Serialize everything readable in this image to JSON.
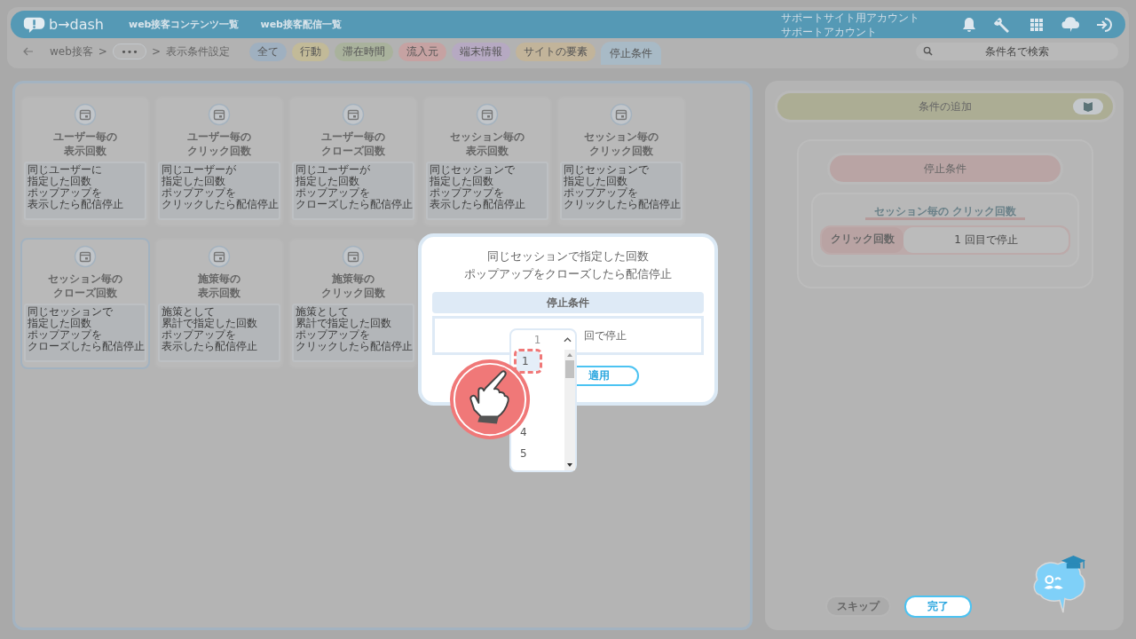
{
  "header": {
    "logo": "b→dash",
    "nav": [
      "web接客コンテンツ一覧",
      "web接客配信一覧"
    ],
    "account": [
      "サポートサイト用アカウント",
      "サポートアカウント"
    ]
  },
  "breadcrumb": [
    {
      "kind": "link",
      "label": "web接客"
    },
    {
      "kind": "sep",
      "label": ">"
    },
    {
      "kind": "more",
      "label": "•••"
    },
    {
      "kind": "sep",
      "label": ">"
    },
    {
      "kind": "current",
      "label": "表示条件設定"
    }
  ],
  "filter_tabs": [
    {
      "label": "全て",
      "color": "#9fb0c0",
      "selected": false
    },
    {
      "label": "行動",
      "color": "#c2ba98",
      "selected": false
    },
    {
      "label": "滞在時間",
      "color": "#a9b29c",
      "selected": false
    },
    {
      "label": "流入元",
      "color": "#c6a2a2",
      "selected": false
    },
    {
      "label": "端末情報",
      "color": "#b6a9c2",
      "selected": false
    },
    {
      "label": "サイトの要素",
      "color": "#c2b49a",
      "selected": false
    },
    {
      "label": "停止条件",
      "color": "#a8bac6",
      "selected": true
    }
  ],
  "search": {
    "placeholder": "条件名で検索"
  },
  "cards": [
    {
      "title": [
        "ユーザー毎の",
        "表示回数"
      ],
      "description": [
        "同じユーザーに",
        "指定した回数",
        "ポップアップを",
        "表示したら配信停止"
      ],
      "selected": false
    },
    {
      "title": [
        "ユーザー毎の",
        "クリック回数"
      ],
      "description": [
        "同じユーザーが",
        "指定した回数",
        "ポップアップを",
        "クリックしたら配信停止"
      ],
      "selected": false
    },
    {
      "title": [
        "ユーザー毎の",
        "クローズ回数"
      ],
      "description": [
        "同じユーザーが",
        "指定した回数",
        "ポップアップを",
        "クローズしたら配信停止"
      ],
      "selected": false
    },
    {
      "title": [
        "セッション毎の",
        "表示回数"
      ],
      "description": [
        "同じセッションで",
        "指定した回数",
        "ポップアップを",
        "表示したら配信停止"
      ],
      "selected": false
    },
    {
      "title": [
        "セッション毎の",
        "クリック回数"
      ],
      "description": [
        "同じセッションで",
        "指定した回数",
        "ポップアップを",
        "クリックしたら配信停止"
      ],
      "selected": false
    },
    {
      "title": [
        "セッション毎の",
        "クローズ回数"
      ],
      "description": [
        "同じセッションで",
        "指定した回数",
        "ポップアップを",
        "クローズしたら配信停止"
      ],
      "selected": true
    },
    {
      "title": [
        "施策毎の",
        "表示回数"
      ],
      "description": [
        "施策として",
        "累計で指定した回数",
        "ポップアップを",
        "表示したら配信停止"
      ],
      "selected": false
    },
    {
      "title": [
        "施策毎の",
        "クリック回数"
      ],
      "description": [
        "施策として",
        "累計で指定した回数",
        "ポップアップを",
        "クリックしたら配信停止"
      ],
      "selected": false
    }
  ],
  "right_panel": {
    "add_button": "条件の追加",
    "group_title": "停止条件",
    "condition": {
      "title": "セッション毎の クリック回数",
      "label": "クリック回数",
      "value": "1 回目で停止"
    }
  },
  "footer_buttons": [
    {
      "kind": "skip",
      "label": "スキップ"
    },
    {
      "kind": "done",
      "label": "完了"
    }
  ],
  "modal": {
    "description": [
      "同じセッションで指定した回数",
      "ポップアップをクローズしたら配信停止"
    ],
    "header": "停止条件",
    "select_value": "1",
    "suffix": "回で停止",
    "apply": "適用",
    "options": [
      {
        "label": "1",
        "selected": true
      },
      {
        "label": "4",
        "selected": false
      },
      {
        "label": "5",
        "selected": false
      }
    ]
  }
}
